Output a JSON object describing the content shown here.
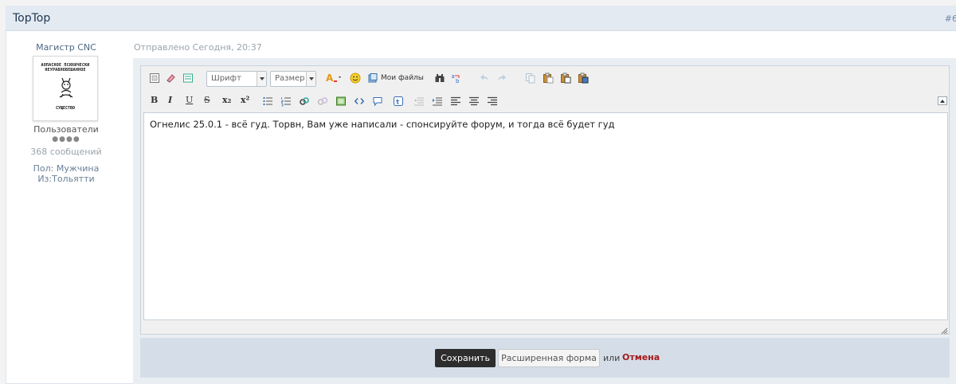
{
  "topic": {
    "title": "TopTop",
    "post_id": "#6"
  },
  "author": {
    "name": "Магистр CNC",
    "avatar_lines": [
      "АОПАСНОЕ ПСИХИЧЕСКИ",
      "НЕУРАВНОВЕШАННОЕ"
    ],
    "avatar_bottom": "СУЩЕСТВО",
    "group": "Пользователи",
    "pips": "●●●●",
    "post_count": "368 сообщений",
    "gender": "Пол: Мужчина",
    "city": "Из:Тольятти"
  },
  "post": {
    "date": "Отправлено Сегодня, 20:37"
  },
  "toolbar": {
    "font_label": "Шрифт",
    "size_label": "Размер",
    "my_files_label": "Мои файлы",
    "format_buttons": [
      "B",
      "I",
      "U",
      "S",
      "x₂",
      "x²"
    ]
  },
  "editor": {
    "text": "Огнелис 25.0.1 - всё гуд. Торвн, Вам уже написали - спонсируйте форум, и тогда всё будет гуд"
  },
  "actions": {
    "save_label": "Сохранить",
    "advanced_label": "Расширенная форма",
    "or_label": "или",
    "cancel_label": "Отмена"
  }
}
